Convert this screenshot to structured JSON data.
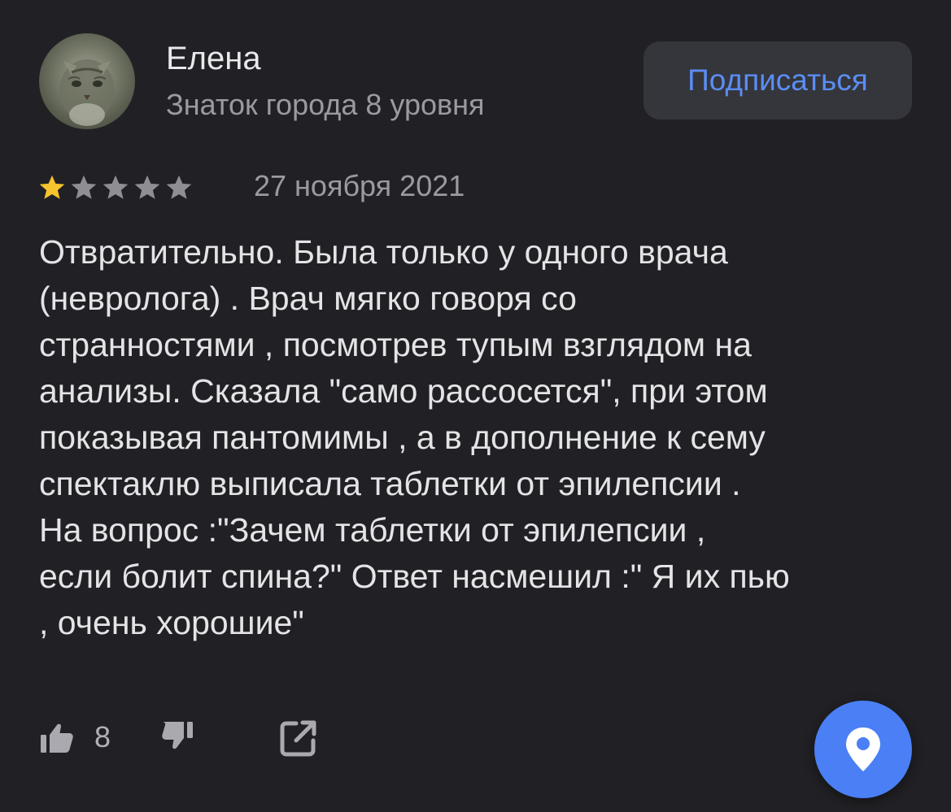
{
  "author": {
    "name": "Елена",
    "level": "Знаток города 8 уровня"
  },
  "subscribe_label": "Подписаться",
  "rating": {
    "value": 1,
    "max": 5,
    "filled_color": "#f7c32e",
    "empty_color": "#8e8e94"
  },
  "date": "27 ноября 2021",
  "review_lines": [
    "Отвратительно. Была только у одного врача",
    "(невролога) . Врач мягко говоря со",
    "странностями , посмотрев тупым взглядом на",
    "анализы. Сказала \"само рассосется\", при этом",
    "показывая пантомимы , а в дополнение к сему",
    "спектаклю выписала таблетки от эпилепсии .",
    "На вопрос :\"Зачем таблетки от эпилепсии ,",
    "если болит спина?\" Ответ насмешил :\" Я их пью",
    ", очень хорошие\""
  ],
  "likes": {
    "count": "8"
  },
  "icons": {
    "like": "thumbs-up-icon",
    "dislike": "thumbs-down-icon",
    "share": "share-icon",
    "map_fab": "map-pin-icon"
  },
  "colors": {
    "background": "#212125",
    "accent": "#4a7ff5",
    "subscribe_text": "#5b8df5"
  }
}
